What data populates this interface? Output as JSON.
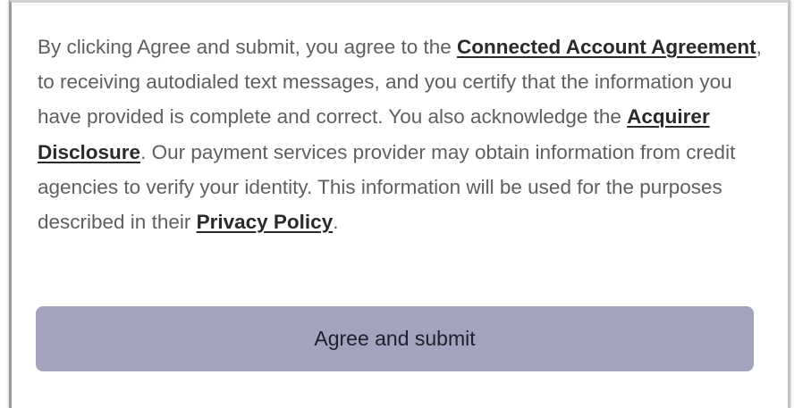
{
  "consent": {
    "text_1": "By clicking Agree and submit, you agree to the ",
    "link_connected_account_agreement": "Connected Account Agreement",
    "text_2": ", to receiving autodialed text messages, and you certify that the information you have provided is complete and correct. You also acknowledge the ",
    "link_acquirer_disclosure": "Acquirer Disclosure",
    "text_3": ". Our payment services provider may obtain information from credit agencies to verify your identity. This information will be used for the purposes described in their ",
    "link_privacy_policy": "Privacy Policy",
    "text_4": "."
  },
  "submit_button": {
    "label": "Agree and submit",
    "background_color": "#a3a3bd"
  }
}
